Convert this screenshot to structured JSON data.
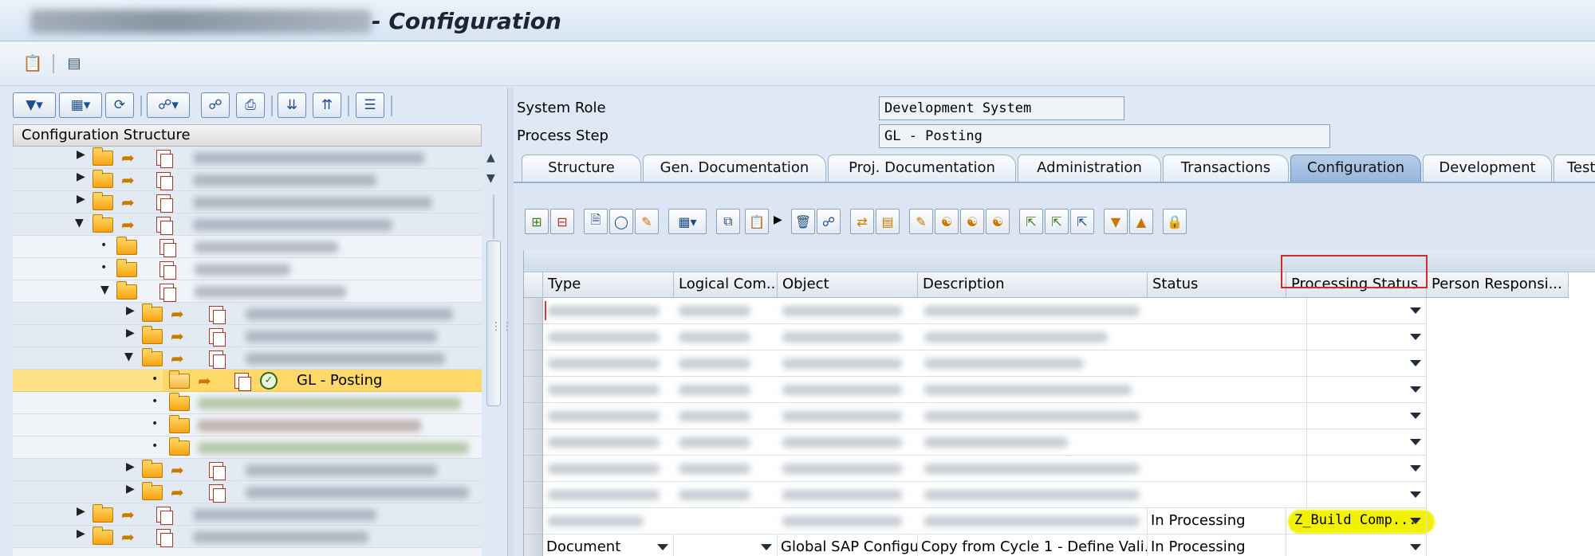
{
  "window": {
    "title_suffix": "- Configuration"
  },
  "tree": {
    "header": "Configuration Structure",
    "selected_item_label": "GL - Posting"
  },
  "fields": {
    "system_role_label": "System Role",
    "system_role_value": "Development System",
    "process_step_label": "Process Step",
    "process_step_value": "GL - Posting"
  },
  "tabs": [
    "Structure",
    "Gen. Documentation",
    "Proj. Documentation",
    "Administration",
    "Transactions",
    "Configuration",
    "Development",
    "Test Case"
  ],
  "active_tab": "Configuration",
  "table": {
    "columns": [
      "Type",
      "Logical Com...",
      "Object",
      "Description",
      "Status",
      "Processing Status",
      "Person Responsi..."
    ],
    "row9": {
      "status": "In Processing",
      "processing_status": "Z_Build Comp..."
    },
    "row10": {
      "type": "Document",
      "object": "Global SAP Configu...",
      "description": "Copy from Cycle 1 - Define Vali...",
      "status": "In Processing"
    }
  },
  "colors": {
    "tab_active": "#98b7dc",
    "selection": "#ffd86a",
    "highlight": "#f2f200",
    "callout": "#d42a2a"
  }
}
